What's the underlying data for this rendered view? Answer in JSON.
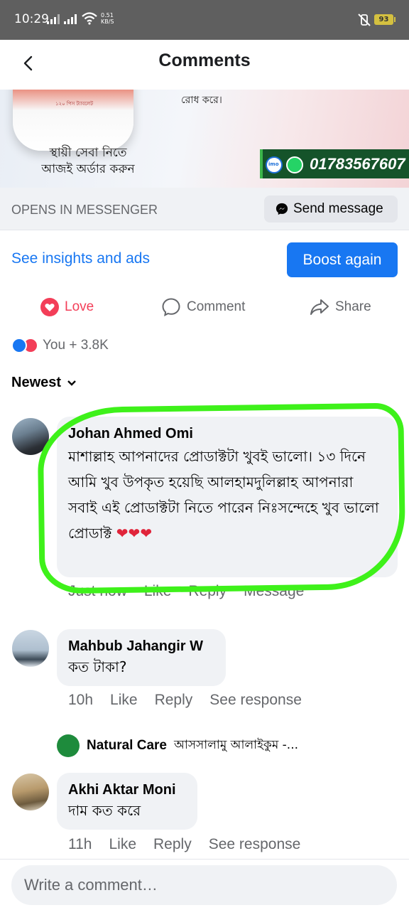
{
  "status_bar": {
    "time": "10:29",
    "speed_value": "0.51",
    "speed_unit": "KB/S",
    "battery": "93"
  },
  "header": {
    "title": "Comments"
  },
  "ad": {
    "text_top": "রোধ করে।",
    "bottle_label": "১২০ পিস ট্যাবলেট",
    "tagline_line1": "স্থায়ী সেবা নিতে",
    "tagline_line2": "আজই অর্ডার করুন",
    "phone": "01783567607"
  },
  "messenger": {
    "opens_label": "OPENS IN MESSENGER",
    "send_message_label": "Send message"
  },
  "insights": {
    "link_label": "See insights and ads",
    "boost_label": "Boost again"
  },
  "actions": {
    "love_label": "Love",
    "comment_label": "Comment",
    "share_label": "Share"
  },
  "reactions": {
    "summary": "You + 3.8K"
  },
  "sort": {
    "label": "Newest"
  },
  "comments": [
    {
      "author": "Johan Ahmed Omi",
      "text": "মাশাল্লাহ আপনাদের প্রোডাক্টটা খুবই ভালো। ১৩ দিনে আমি খুব উপকৃত হয়েছি আলহামদুলিল্লাহ আপনারা সবাই এই প্রোডাক্টটা নিতে পারেন নিঃসন্দেহে খুব ভালো প্রোডাক্ট",
      "hearts": "❤❤❤",
      "time": "Just now",
      "like": "Like",
      "reply": "Reply",
      "extra": "Message"
    },
    {
      "author": "Mahbub Jahangir W",
      "text": "কত টাকা?",
      "time": "10h",
      "like": "Like",
      "reply": "Reply",
      "extra": "See response"
    },
    {
      "author": "Akhi Aktar Moni",
      "text": "দাম কত করে",
      "time": "11h",
      "like": "Like",
      "reply": "Reply",
      "extra": "See response"
    }
  ],
  "reply_preview": {
    "author": "Natural Care",
    "snippet": "আসসালামু আলাইকুম -..."
  },
  "composer": {
    "placeholder": "Write a comment…"
  },
  "colors": {
    "accent": "#1877f2",
    "love": "#f33e58",
    "highlight": "#3ef11a"
  }
}
